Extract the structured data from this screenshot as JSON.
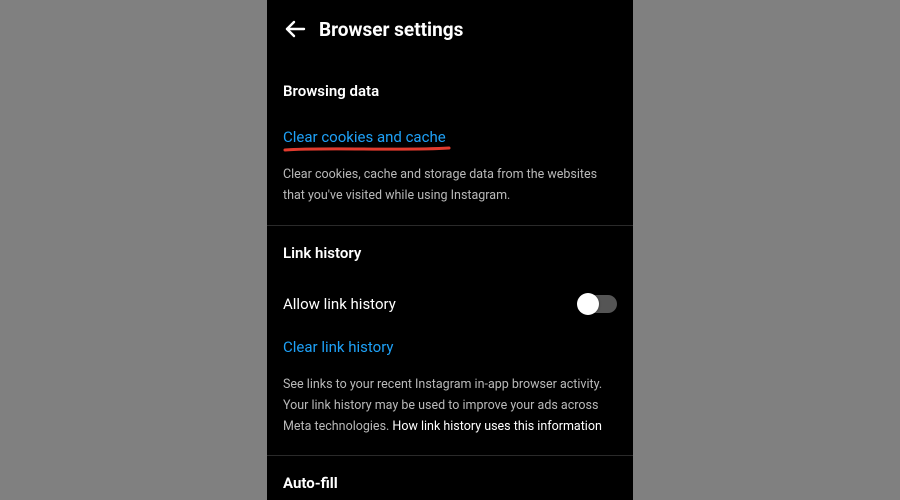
{
  "header": {
    "title": "Browser settings"
  },
  "browsing_data": {
    "section_title": "Browsing data",
    "clear_label": "Clear cookies and cache",
    "clear_desc": "Clear cookies, cache and storage data from the websites that you've visited while using Instagram."
  },
  "link_history": {
    "section_title": "Link history",
    "allow_label": "Allow link history",
    "allow_state": "off",
    "clear_label": "Clear link history",
    "desc_text": "See links to your recent Instagram in-app browser activity. Your link history may be used to improve your ads across Meta technologies. ",
    "desc_more": "How link history uses this information"
  },
  "autofill": {
    "section_title": "Auto-fill"
  },
  "accent_color": "#1ea1f7",
  "annotation_color": "#e23b2e"
}
